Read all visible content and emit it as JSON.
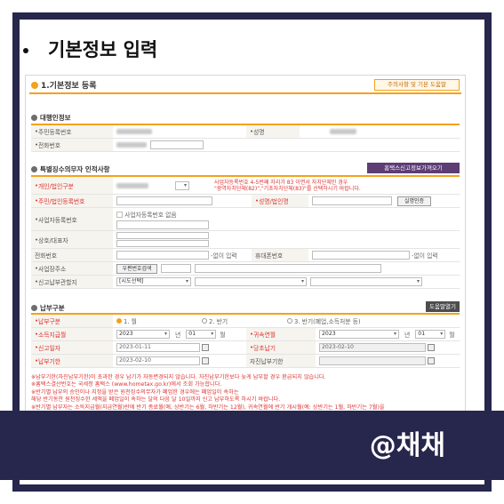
{
  "headline": "기본정보 입력",
  "watermark": "@채채",
  "shot": {
    "title": "1.기본정보 등록",
    "help_button": "주의사항 및 기본 도움말",
    "sections": {
      "agent": "대행인정보",
      "special": "특별징수의무자 인적사항",
      "payment": "납부구분"
    },
    "agent_rows": [
      {
        "label": "주민등록번호",
        "label2": "성명"
      },
      {
        "label": "전화번호"
      }
    ],
    "special_button": "홈택스신고정보가져오기",
    "special_note1": "사업자등록번호 4-5번째 자리가 83 이면서 자치단체인 경우",
    "special_note2": "\"광역자치단체(82)\",\"기초자치단체(83)\"를 선택하시기 바랍니다.",
    "special_rows": {
      "type": "개인/법인구분",
      "resident": "주민/법인등록번호",
      "name": "성명/법인명",
      "real_name_btn": "실명인증",
      "bizno": "사업자등록번호",
      "bizno_check": "사업자등록번호 없음",
      "company": "상호/대표자",
      "phone": "전화번호",
      "no_input1": "-없이 입력",
      "mobile": "휴대폰번호",
      "no_input2": "-없이 입력",
      "address": "사업장주소",
      "zip_btn": "우편번호검색",
      "region": "신고납부관할지",
      "region_select": "[시도선택]"
    },
    "payment_help": "도움말열기",
    "payment_rows": {
      "kind": "납부구분",
      "opt1": "1. 월",
      "opt2": "2. 반기",
      "opt3": "3. 반기(폐업,소득처분 등)",
      "income_month": "소득지급월",
      "year1": "2023",
      "year_unit": "년",
      "month1": "01",
      "month_unit": "월",
      "attr_month": "귀속연월",
      "year2": "2023",
      "month2": "01",
      "report_date_label": "신고일자",
      "report_date": "2023-01-11",
      "due_date_label": "당초납기",
      "due_date": "2023-02-10",
      "pay_due_label": "납부기한",
      "pay_due": "2023-02-10",
      "self_pay_label": "자진납부기한"
    },
    "notes": [
      "※납부기한(자진납부기한)이 초과한 경우 납기가 자동변경되지 않습니다. 자진납부기한보다 늦게 납부할 경우 환급되지 않습니다.",
      "※홈택스결산번호는 국세청 홈택스 (www.hometax.go.kr)에서 조회 가능합니다.",
      "※반기별 납부의 승인이나 지정을 받은 원천징수의무자가 폐업한 경우에는 폐업일이 속하는",
      "  해당 반기동안 원천징수한 세액을 폐업일이 속하는 달의 다음 달 10일까지 신고 납부하도록 하시기 바랍니다.",
      "※반기별 납부자는 소득지급월(지급연월)란에 반기 종료월(예, 상반기는 6월, 하반기는 12월), 귀속연월에 반기 개시월(예: 상반기는 1월, 하반기는 7월)을"
    ]
  }
}
